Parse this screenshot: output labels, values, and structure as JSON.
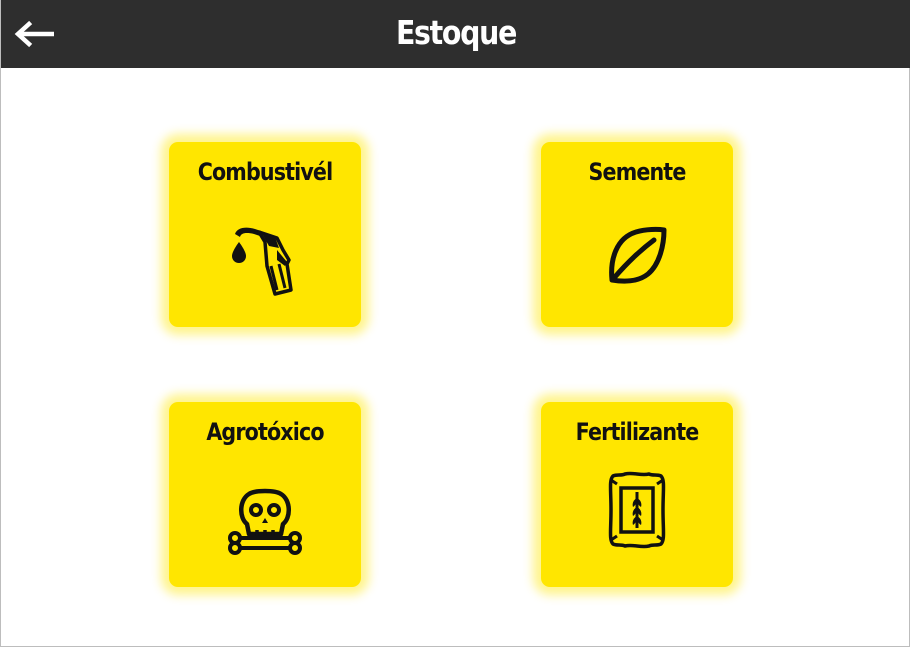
{
  "header": {
    "title": "Estoque",
    "back_icon": "arrow-left-icon"
  },
  "categories": [
    {
      "label": "Combustivél",
      "icon": "fuel-nozzle-icon"
    },
    {
      "label": "Semente",
      "icon": "leaf-icon"
    },
    {
      "label": "Agrotóxico",
      "icon": "skull-crossbones-icon"
    },
    {
      "label": "Fertilizante",
      "icon": "fertilizer-bag-icon"
    }
  ],
  "colors": {
    "header_bg": "#2e2e2e",
    "card_bg": "#ffe600",
    "icon": "#111111",
    "title_text": "#ffffff"
  }
}
